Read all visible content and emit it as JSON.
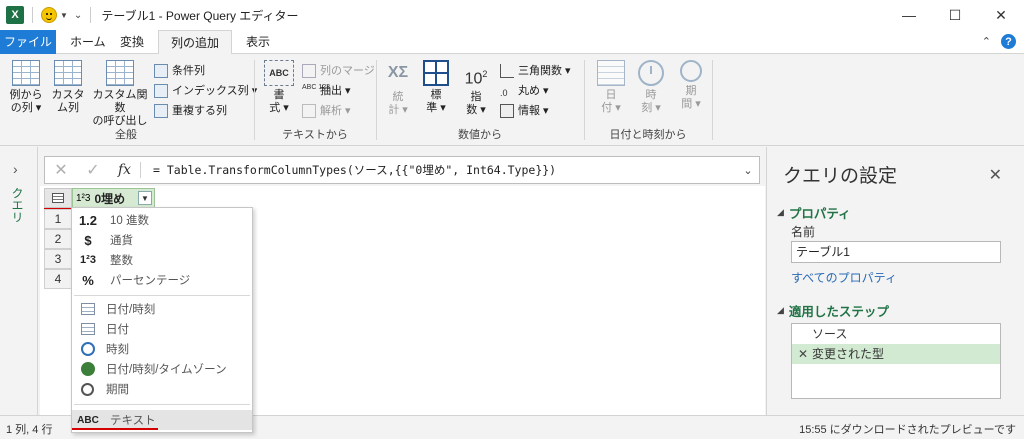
{
  "titlebar": {
    "app_icon": "excel-icon",
    "title": "テーブル1 - Power Query エディター",
    "minimize": "—",
    "maximize": "☐",
    "close": "✕"
  },
  "tabs": {
    "file": "ファイル",
    "items": [
      "ホーム",
      "変換",
      "列の追加",
      "表示"
    ],
    "active": "列の追加"
  },
  "ribbon": {
    "general": {
      "label": "全般",
      "column_from_examples": [
        "例から",
        "の列 ▾"
      ],
      "custom_column": [
        "カスタ",
        "ム列"
      ],
      "invoke_custom_function": [
        "カスタム関数",
        "の呼び出し"
      ],
      "conditional_column": "条件列",
      "index_column": "インデックス列 ▾",
      "duplicate_column": "重複する列"
    },
    "text": {
      "label": "テキストから",
      "format": [
        "書",
        "式 ▾"
      ],
      "merge_columns": "列のマージ",
      "extract": "抽出 ▾",
      "parse": "解析 ▾"
    },
    "number": {
      "label": "数値から",
      "statistics": [
        "統",
        "計 ▾"
      ],
      "standard": [
        "標",
        "準 ▾"
      ],
      "scientific": [
        "指",
        "数 ▾"
      ],
      "trigonometry": "三角関数 ▾",
      "rounding": "丸め ▾",
      "information": "情報 ▾"
    },
    "datetime": {
      "label": "日付と時刻から",
      "date": [
        "日",
        "付 ▾"
      ],
      "time": [
        "時",
        "刻 ▾"
      ],
      "duration": [
        "期",
        "間 ▾"
      ]
    }
  },
  "leftpane": {
    "label": "クエリ",
    "chevron": "›"
  },
  "formula": {
    "cancel": "✕",
    "commit": "✓",
    "fx": "fx",
    "text": "= Table.TransformColumnTypes(ソース,{{\"0埋め\", Int64.Type}})"
  },
  "grid": {
    "column_header": "0埋め",
    "column_type_icon": "1²3",
    "rows": [
      "1",
      "2",
      "3",
      "4"
    ]
  },
  "type_menu": {
    "items": [
      {
        "icon": "1.2",
        "label": "10 進数"
      },
      {
        "icon": "$",
        "label": "通貨"
      },
      {
        "icon": "1²3",
        "label": "整数"
      },
      {
        "icon": "%",
        "label": "パーセンテージ"
      },
      {
        "icon": "datetime-icon",
        "label": "日付/時刻"
      },
      {
        "icon": "calendar-icon",
        "label": "日付"
      },
      {
        "icon": "clock-icon",
        "label": "時刻"
      },
      {
        "icon": "globe-icon",
        "label": "日付/時刻/タイムゾーン"
      },
      {
        "icon": "timer-icon",
        "label": "期間"
      },
      {
        "icon": "ABC",
        "label": "テキスト"
      }
    ]
  },
  "settings": {
    "title": "クエリの設定",
    "close": "✕",
    "properties_header": "プロパティ",
    "name_label": "名前",
    "name_value": "テーブル1",
    "all_properties": "すべてのプロパティ",
    "applied_steps_header": "適用したステップ",
    "steps": [
      "ソース",
      "変更された型"
    ]
  },
  "status": {
    "left": "1 列, 4 行",
    "right": "15:55 にダウンロードされたプレビューです"
  },
  "colors": {
    "excel_green": "#217346",
    "file_tab": "#1e7bd6",
    "selected_step": "#d3ead2",
    "column_header": "#d6e9d2",
    "annotation_red": "#d40000"
  }
}
